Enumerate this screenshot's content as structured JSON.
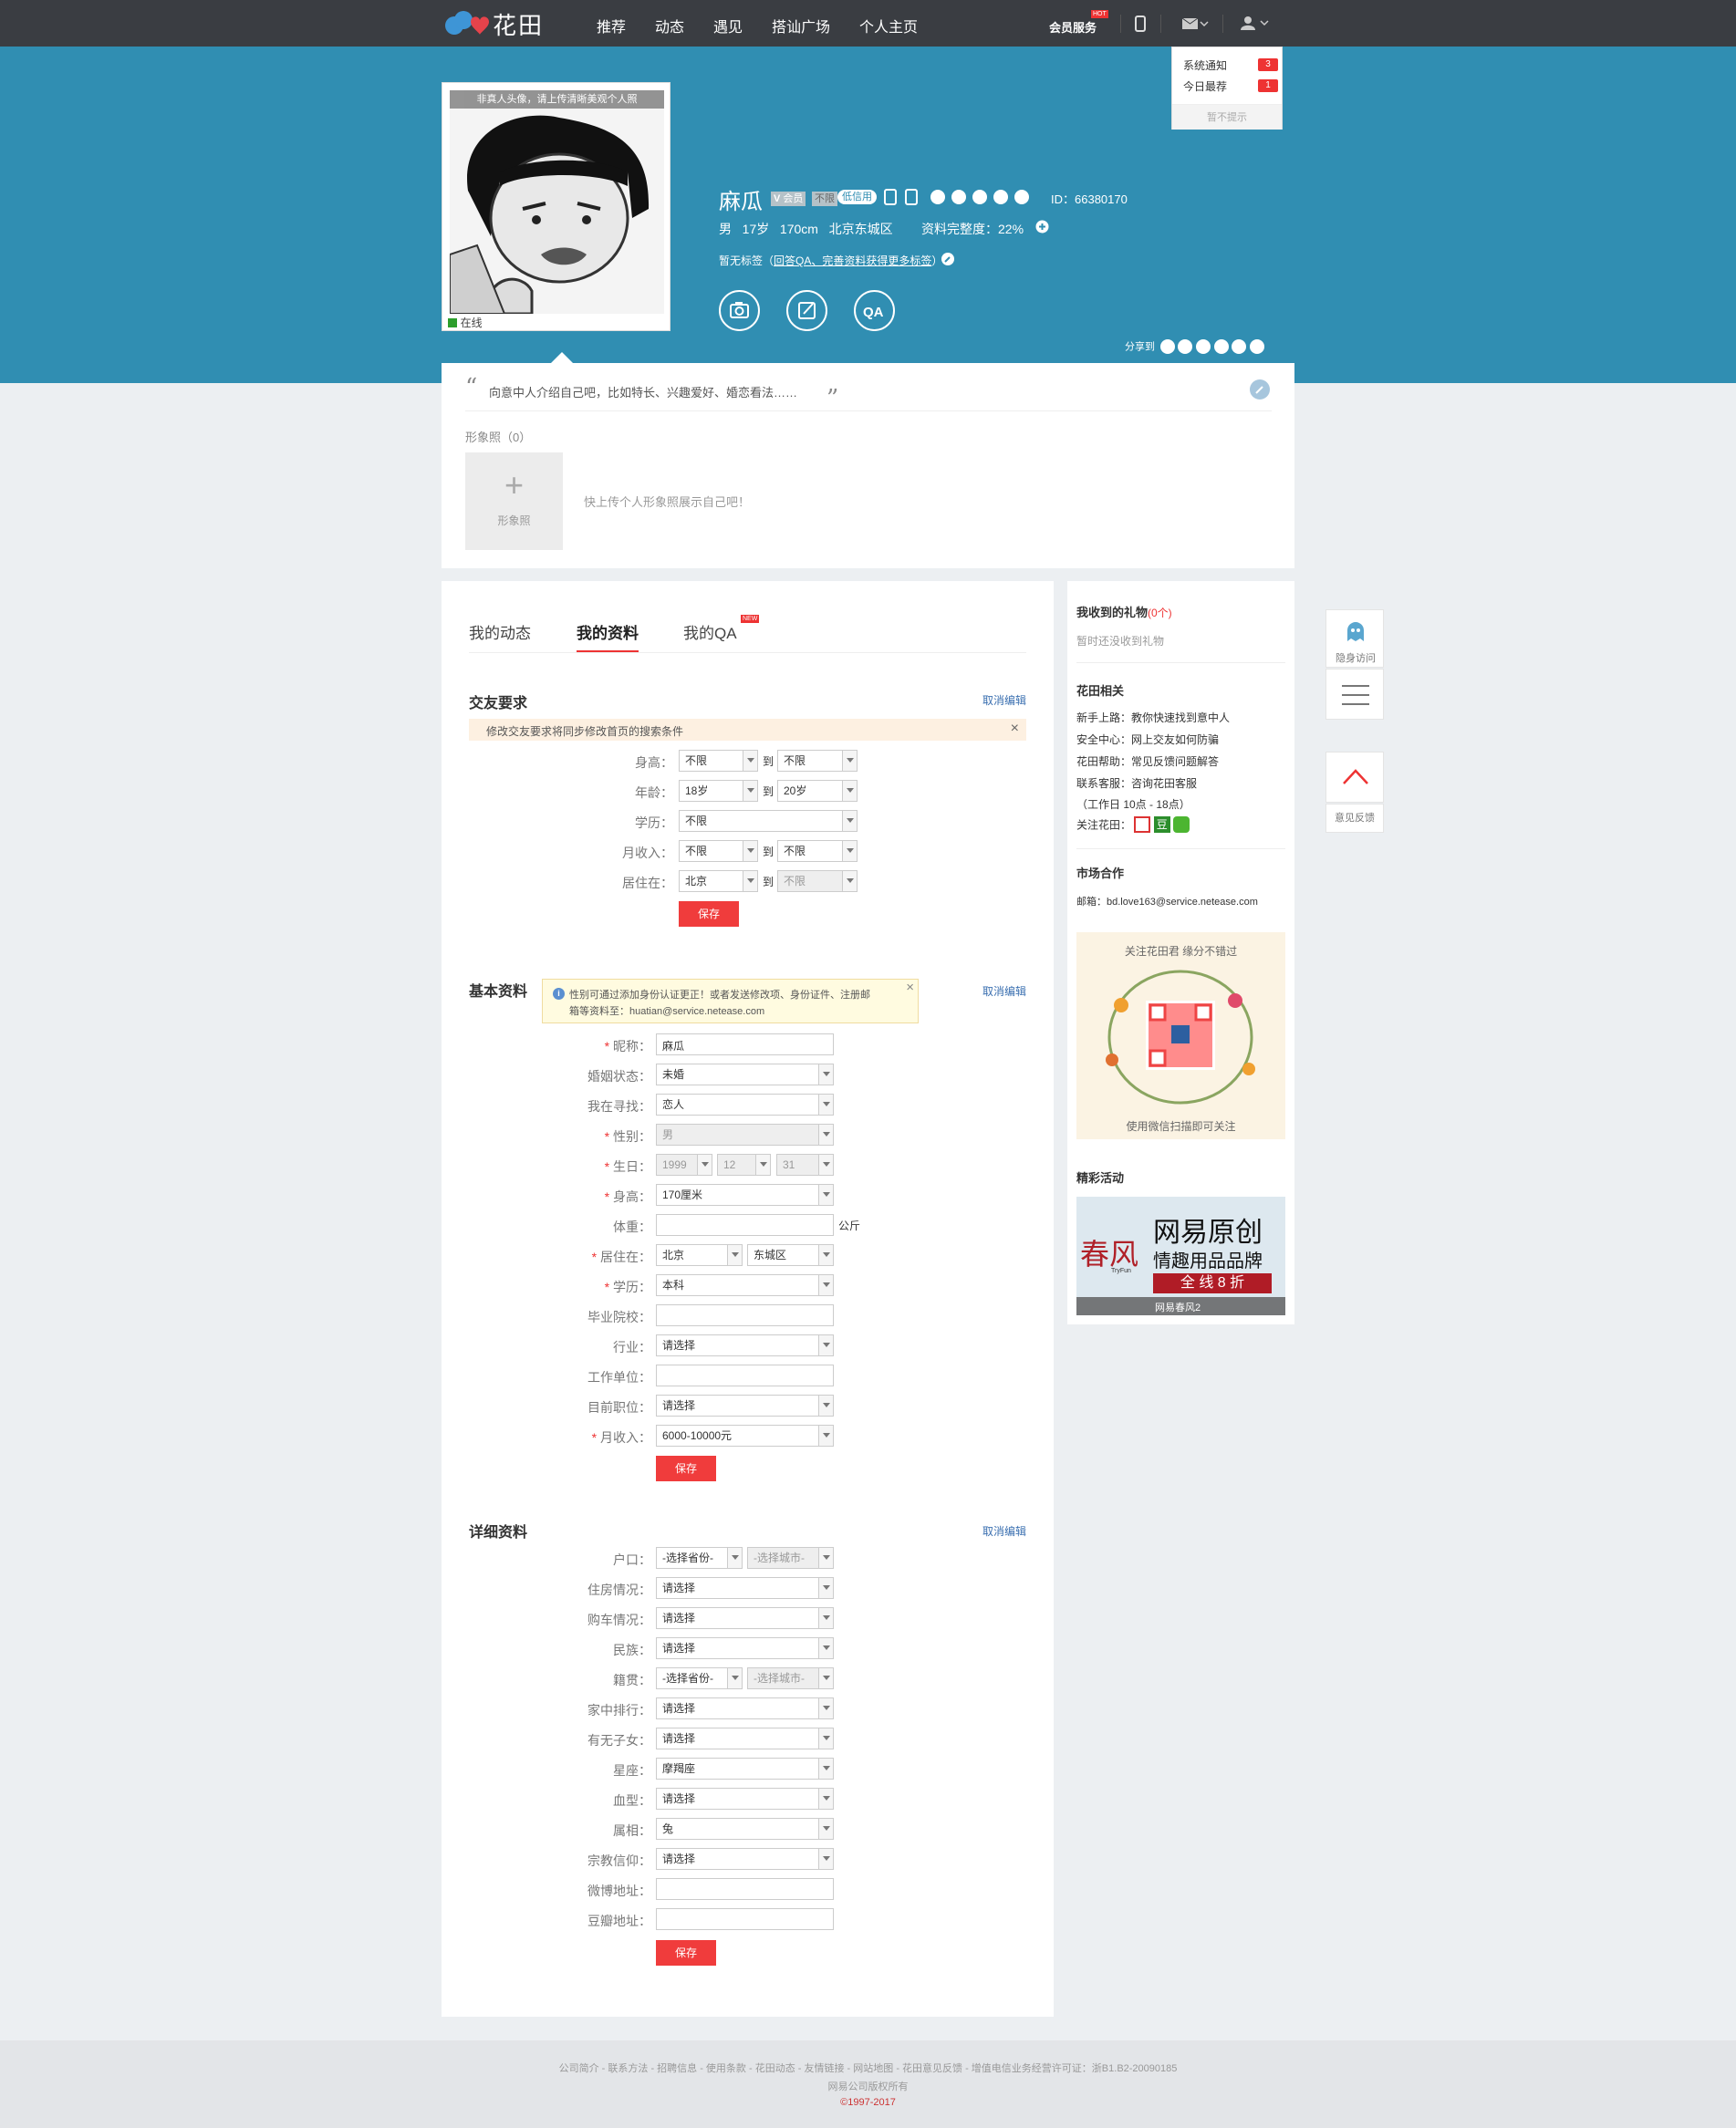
{
  "topbar": {
    "logo_text": "花田",
    "nav": [
      "推荐",
      "动态",
      "遇见",
      "搭讪广场",
      "个人主页"
    ],
    "vip_label": "会员服务",
    "vip_badge": "HOT"
  },
  "notice_dropdown": {
    "items": [
      {
        "label": "系统通知",
        "count": "3"
      },
      {
        "label": "今日最荐",
        "count": "1"
      }
    ],
    "mute": "暂不提示"
  },
  "profile": {
    "avatar_tip": "非真人头像，请上传清晰美观个人照",
    "online": "在线",
    "name": "麻瓜",
    "member": "会员",
    "member_status": "不限",
    "credit": "低信用",
    "id_text": "ID：66380170",
    "gender": "男",
    "age": "17岁",
    "height": "170cm",
    "location": "北京东城区",
    "completion_label": "资料完整度：",
    "completion": "22%",
    "tags_prefix": "暂无标签（",
    "tags_link": "回答QA、完善资料获得更多标签",
    "tags_suffix": "）",
    "share_label": "分享到"
  },
  "intro": {
    "text": "向意中人介绍自己吧，比如特长、兴趣爱好、婚恋看法……",
    "photos_label": "形象照（0）",
    "add_photo": "形象照",
    "photo_prompt": "快上传个人形象照展示自己吧！"
  },
  "tabs": [
    "我的动态",
    "我的资料",
    "我的QA"
  ],
  "tab_new_badge": "NEW",
  "pref": {
    "title": "交友要求",
    "cancel": "取消编辑",
    "notice": "修改交友要求将同步修改首页的搜索条件",
    "to": "到",
    "rows": [
      {
        "label": "身高：",
        "v1": "不限",
        "v2": "不限"
      },
      {
        "label": "年龄：",
        "v1": "18岁",
        "v2": "20岁"
      },
      {
        "label": "学历：",
        "v1": "不限"
      },
      {
        "label": "月收入：",
        "v1": "不限",
        "v2": "不限"
      },
      {
        "label": "居住在：",
        "v1": "北京",
        "v2": "不限"
      }
    ],
    "save": "保存"
  },
  "basic": {
    "title": "基本资料",
    "cancel": "取消编辑",
    "tip_line1": "性别可通过添加身份认证更正！或者发送修改项、身份证件、注册邮",
    "tip_line2": "箱等资料至：huatian@service.netease.com",
    "rows": [
      {
        "label": "昵称：",
        "req": "*",
        "value": "麻瓜",
        "kind": "input"
      },
      {
        "label": "婚姻状态：",
        "req": "",
        "value": "未婚",
        "kind": "select"
      },
      {
        "label": "我在寻找：",
        "req": "",
        "value": "恋人",
        "kind": "select"
      },
      {
        "label": "性别：",
        "req": "*",
        "value": "男",
        "kind": "select-dis"
      },
      {
        "label": "生日：",
        "req": "*",
        "value": "",
        "kind": "birthday"
      },
      {
        "label": "身高：",
        "req": "*",
        "value": "170厘米",
        "kind": "select"
      },
      {
        "label": "体重：",
        "req": "",
        "value": "",
        "kind": "input-unit"
      },
      {
        "label": "居住在：",
        "req": "*",
        "value": "",
        "kind": "location"
      },
      {
        "label": "学历：",
        "req": "*",
        "value": "本科",
        "kind": "select"
      },
      {
        "label": "毕业院校：",
        "req": "",
        "value": "",
        "kind": "input"
      },
      {
        "label": "行业：",
        "req": "",
        "value": "请选择",
        "kind": "select"
      },
      {
        "label": "工作单位：",
        "req": "",
        "value": "",
        "kind": "input"
      },
      {
        "label": "目前职位：",
        "req": "",
        "value": "请选择",
        "kind": "select"
      },
      {
        "label": "月收入：",
        "req": "*",
        "value": "6000-10000元",
        "kind": "select"
      }
    ],
    "birthday": [
      "1999",
      "12",
      "31"
    ],
    "weight_unit": "公斤",
    "city": "北京",
    "district": "东城区",
    "save": "保存"
  },
  "detail": {
    "title": "详细资料",
    "cancel": "取消编辑",
    "rows": [
      {
        "label": "户口：",
        "value": "-选择省份-",
        "value2": "-选择城市-",
        "kind": "double"
      },
      {
        "label": "住房情况：",
        "value": "请选择",
        "kind": "select"
      },
      {
        "label": "购车情况：",
        "value": "请选择",
        "kind": "select"
      },
      {
        "label": "民族：",
        "value": "请选择",
        "kind": "select"
      },
      {
        "label": "籍贯：",
        "value": "-选择省份-",
        "value2": "-选择城市-",
        "kind": "double"
      },
      {
        "label": "家中排行：",
        "value": "请选择",
        "kind": "select"
      },
      {
        "label": "有无子女：",
        "value": "请选择",
        "kind": "select"
      },
      {
        "label": "星座：",
        "value": "摩羯座",
        "kind": "select"
      },
      {
        "label": "血型：",
        "value": "请选择",
        "kind": "select"
      },
      {
        "label": "属相：",
        "value": "兔",
        "kind": "select"
      },
      {
        "label": "宗教信仰：",
        "value": "请选择",
        "kind": "select"
      },
      {
        "label": "微博地址：",
        "value": "",
        "kind": "input"
      },
      {
        "label": "豆瓣地址：",
        "value": "",
        "kind": "input"
      }
    ],
    "save": "保存"
  },
  "sidebar": {
    "gifts_title": "我收到的礼物",
    "gifts_count": "(0个)",
    "gifts_empty": "暂时还没收到礼物",
    "related_title": "花田相关",
    "related": [
      {
        "k": "新手上路：",
        "v": "教你快速找到意中人"
      },
      {
        "k": "安全中心：",
        "v": "网上交友如何防骗"
      },
      {
        "k": "花田帮助：",
        "v": "常见反馈问题解答"
      },
      {
        "k": "联系客服：",
        "v": "咨询花田客服"
      }
    ],
    "service_hours": "（工作日 10点 - 18点）",
    "follow_label": "关注花田：",
    "market_title": "市场合作",
    "email_label": "邮箱：",
    "email": "bd.love163@service.netease.com",
    "qr_top": "关注花田君 缘分不错过",
    "qr_bottom": "使用微信扫描即可关注",
    "events_title": "精彩活动",
    "ad_logo": "春风",
    "ad_logo_sub": "TryFun",
    "ad_line1": "网易原创",
    "ad_line2": "情趣用品品牌",
    "ad_line3": "全 线 8 折",
    "ad_caption": "网易春风2"
  },
  "float": {
    "stealth": "隐身访问",
    "feedback": "意见反馈"
  },
  "footer": {
    "links": "公司简介 - 联系方法 - 招聘信息 - 使用条款 - 花田动态 - 友情链接 - 网站地图 - 花田意见反馈 - 增值电信业务经营许可证：浙B1.B2-20090185",
    "owner": "网易公司版权所有",
    "copyright": "©1997-2017"
  },
  "colors": {
    "accent": "#308eb2",
    "topbar": "#3a3d42",
    "red": "#f03c3c"
  }
}
